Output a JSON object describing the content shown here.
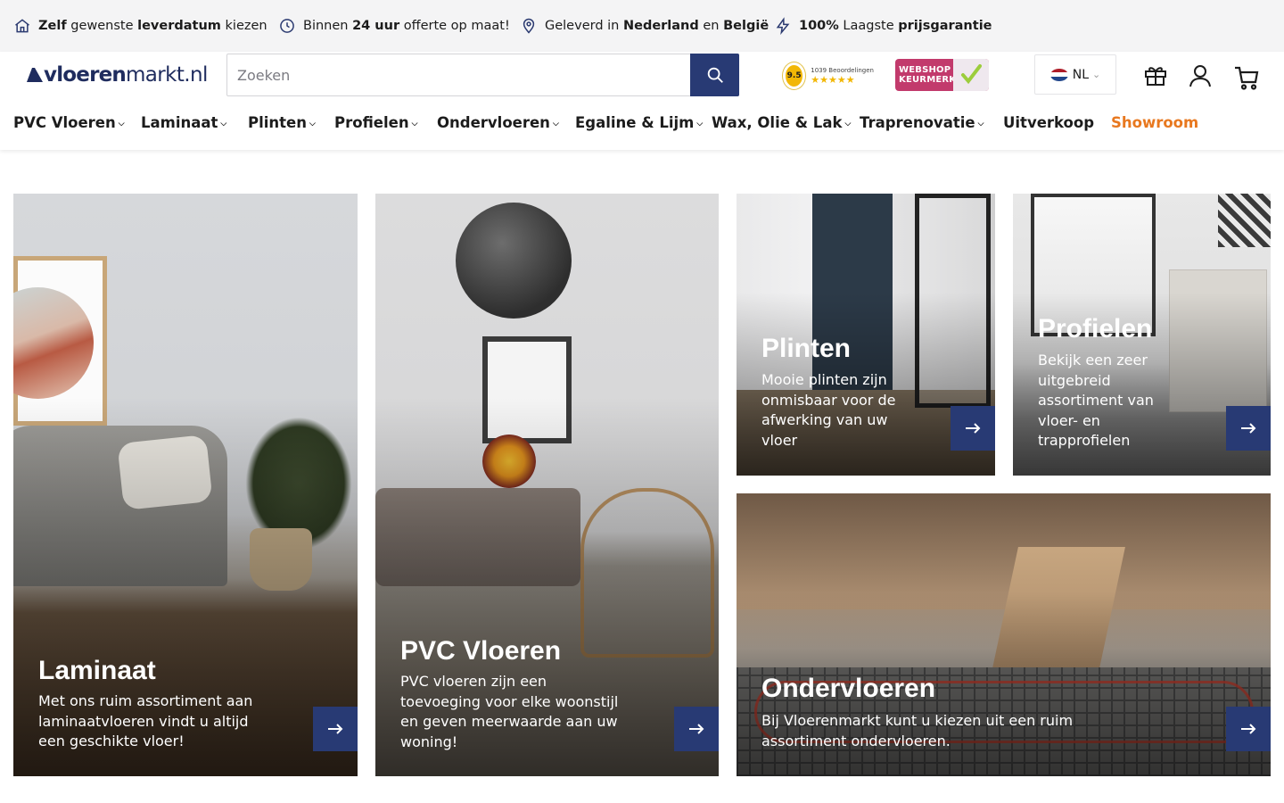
{
  "usp_bar": {
    "items": [
      {
        "icon": "home-icon",
        "parts": [
          {
            "bold": "Zelf"
          },
          {
            "text": " gewenste "
          },
          {
            "bold": "leverdatum"
          },
          {
            "text": " kiezen"
          }
        ]
      },
      {
        "icon": "clock-icon",
        "parts": [
          {
            "text": "Binnen "
          },
          {
            "bold": "24 uur"
          },
          {
            "text": " offerte op maat!"
          }
        ]
      },
      {
        "icon": "location-pin-icon",
        "parts": [
          {
            "text": "Geleverd in "
          },
          {
            "bold": "Nederland"
          },
          {
            "text": " en "
          },
          {
            "bold": "België"
          }
        ]
      },
      {
        "icon": "lightning-icon",
        "parts": [
          {
            "bold": "100%"
          },
          {
            "text": " Laagste "
          },
          {
            "bold": "prijsgarantie"
          }
        ]
      }
    ]
  },
  "header": {
    "logo_bold": "vloeren",
    "logo_thin": "markt.nl",
    "search_placeholder": "Zoeken",
    "search_value": "",
    "rating_score": "9.5",
    "rating_count": "1039 Beoordelingen",
    "rating_stars": "★★★★★",
    "keurmerk_line1": "WEBSHOP",
    "keurmerk_line2": "KEURMERK",
    "language": "NL",
    "icons": [
      "gift-box-icon",
      "user-icon",
      "shopping-cart-icon"
    ]
  },
  "nav": {
    "items": [
      {
        "label": "PVC Vloeren",
        "dropdown": true
      },
      {
        "label": "Laminaat",
        "dropdown": true
      },
      {
        "label": "Plinten",
        "dropdown": true
      },
      {
        "label": "Profielen",
        "dropdown": true
      },
      {
        "label": "Ondervloeren",
        "dropdown": true
      },
      {
        "label": "Egaline & Lijm",
        "dropdown": true
      },
      {
        "label": "Wax, Olie & Lak",
        "dropdown": true
      },
      {
        "label": "Traprenovatie",
        "dropdown": true
      },
      {
        "label": "Uitverkoop",
        "dropdown": false
      },
      {
        "label": "Showroom",
        "dropdown": false,
        "highlight": true
      }
    ]
  },
  "tiles": [
    {
      "title": "Laminaat",
      "text": "Met ons ruim assortiment aan laminaatvloeren vindt u altijd een geschikte vloer!"
    },
    {
      "title": "PVC Vloeren",
      "text": "PVC vloeren zijn een toevoeging voor elke woonstijl en geven meerwaarde aan uw woning!"
    },
    {
      "title": "Plinten",
      "text": "Mooie plinten zijn onmisbaar voor de afwerking van uw vloer"
    },
    {
      "title": "Profielen",
      "text": "Bekijk een zeer uitgebreid assortiment van vloer- en trapprofielen"
    },
    {
      "title": "Ondervloeren",
      "text": "Bij Vloerenmarkt kunt u kiezen uit een ruim assortiment ondervloeren."
    }
  ],
  "colors": {
    "brand_navy": "#283a74",
    "highlight_orange": "#e8781f",
    "usp_background": "#f4f4f5"
  }
}
